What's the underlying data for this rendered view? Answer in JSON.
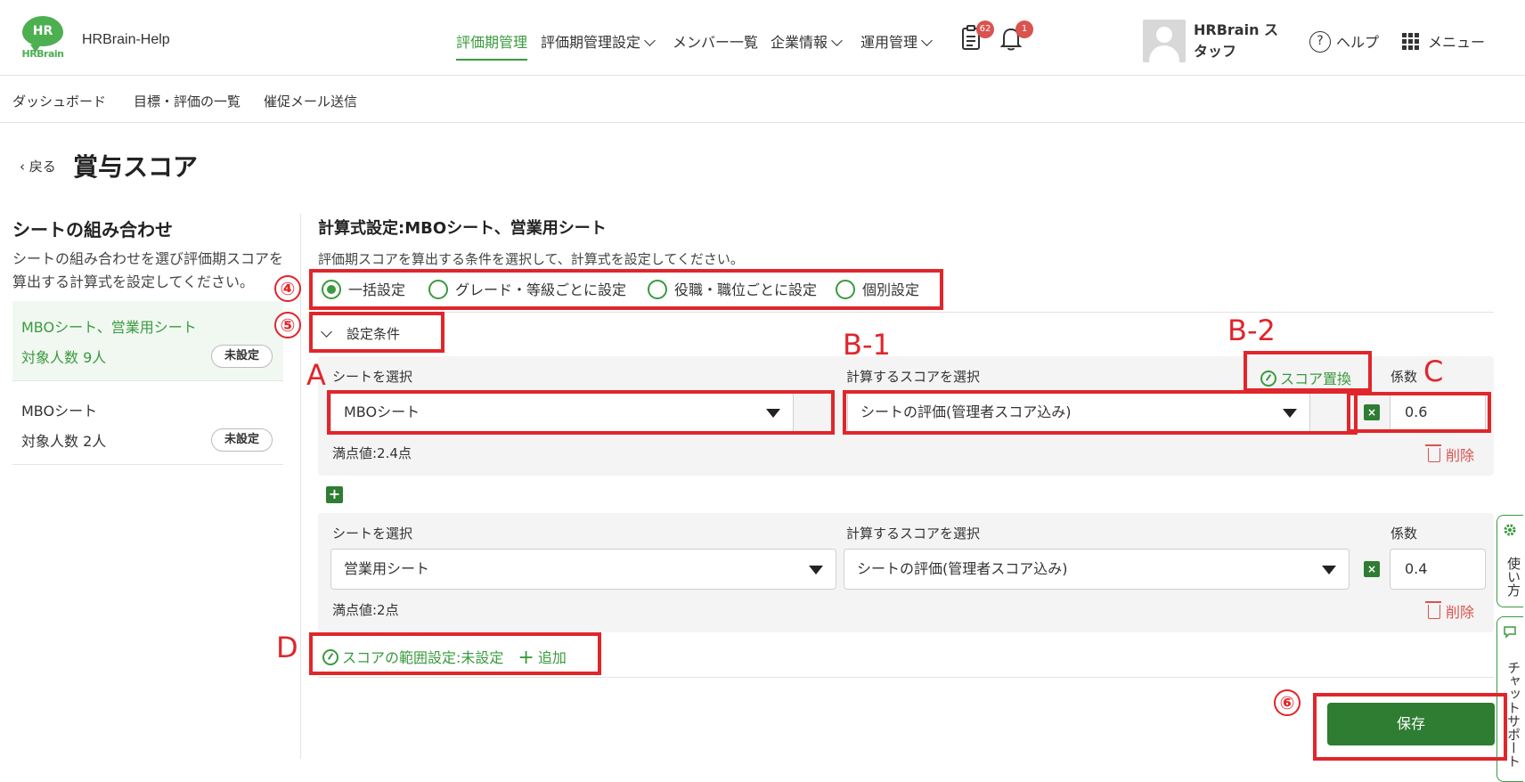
{
  "header": {
    "logo_text": "HR",
    "logo_sub": "HRBrain",
    "brand": "HRBrain-Help",
    "nav": [
      {
        "label": "評価期管理"
      },
      {
        "label": "評価期管理設定"
      },
      {
        "label": "メンバー一覧"
      },
      {
        "label": "企業情報"
      },
      {
        "label": "運用管理"
      }
    ],
    "task_badge": "62",
    "notif_badge": "1",
    "user_name": "HRBrain スタッフ",
    "help": "ヘルプ",
    "menu": "メニュー",
    "help_glyph": "?"
  },
  "subnav": [
    "ダッシュボード",
    "目標・評価の一覧",
    "催促メール送信"
  ],
  "page": {
    "back": "戻る",
    "title": "賞与スコア"
  },
  "left": {
    "title": "シートの組み合わせ",
    "desc": "シートの組み合わせを選び評価期スコアを算出する計算式を設定してください。",
    "combos": [
      {
        "name": "MBOシート、営業用シート",
        "count": "対象人数 9人",
        "status": "未設定"
      },
      {
        "name": "MBOシート",
        "count": "対象人数 2人",
        "status": "未設定"
      }
    ]
  },
  "formula": {
    "title": "計算式設定:MBOシート、営業用シート",
    "desc": "評価期スコアを算出する条件を選択して、計算式を設定してください。",
    "modes": [
      "一括設定",
      "グレード・等級ごとに設定",
      "役職・職位ごとに設定",
      "個別設定"
    ],
    "conditions": "設定条件",
    "rows": [
      {
        "sheet_label": "シートを選択",
        "sheet": "MBOシート",
        "score_label": "計算するスコアを選択",
        "score": "シートの評価(管理者スコア込み)",
        "swap": "スコア置換",
        "coef_label": "係数",
        "coef": "0.6",
        "max": "満点値:2.4点",
        "delete": "削除"
      },
      {
        "sheet_label": "シートを選択",
        "sheet": "営業用シート",
        "score_label": "計算するスコアを選択",
        "score": "シートの評価(管理者スコア込み)",
        "coef_label": "係数",
        "coef": "0.4",
        "max": "満点値:2点",
        "delete": "削除"
      }
    ],
    "range": "スコアの範囲設定:未設定",
    "add": "追加",
    "save": "保存",
    "x_glyph": "×",
    "plus_glyph": "+"
  },
  "sidetabs": {
    "howto": "使い方",
    "chat": "チャットサポート"
  },
  "annotations": {
    "n4": "④",
    "n5": "⑤",
    "n6": "⑥",
    "A": "A",
    "B1": "B-1",
    "B2": "B-2",
    "C": "C",
    "D": "D"
  },
  "colors": {
    "accent": "#3a9a3e",
    "button": "#2e7d32",
    "annotation": "#e0262b",
    "danger": "#d9534f"
  }
}
